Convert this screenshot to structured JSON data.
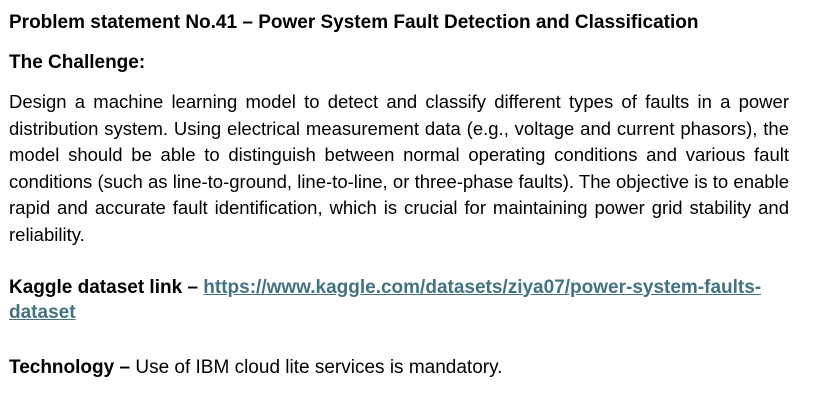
{
  "problem": {
    "title": "Problem statement No.41 – Power System Fault Detection and Classification"
  },
  "challenge": {
    "heading": "The Challenge:",
    "description": "Design a machine learning model to detect and classify different types of faults in a power distribution system. Using electrical measurement data (e.g., voltage and current phasors), the model should be able to distinguish between normal operating conditions and various fault conditions (such as line-to-ground, line-to-line, or three-phase faults). The objective is to enable rapid and accurate fault identification, which is crucial for maintaining power grid stability and reliability."
  },
  "dataset": {
    "label": "Kaggle dataset link – ",
    "url": "https://www.kaggle.com/datasets/ziya07/power-system-faults-dataset",
    "link_color": "#44727f"
  },
  "technology": {
    "label": "Technology –",
    "text": " Use of IBM cloud lite services is mandatory."
  }
}
